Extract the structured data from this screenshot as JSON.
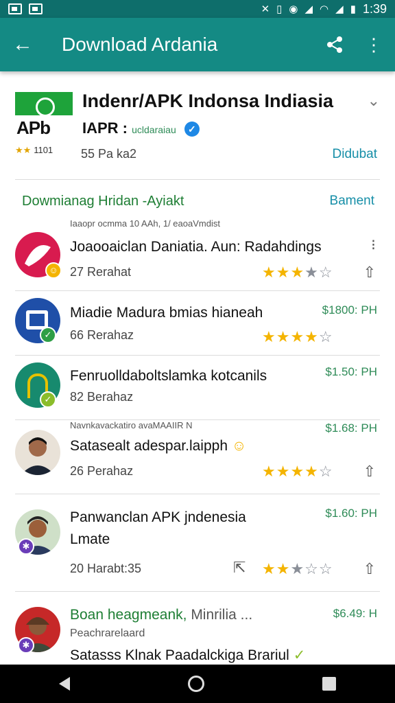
{
  "status_bar": {
    "time": "1:39"
  },
  "app_bar": {
    "title": "Download Ardania"
  },
  "app": {
    "title": "Indenr/APK Indonsa Indiasia",
    "logo_text": "APb",
    "developer": "IAPR :",
    "developer_tag": "ucldaraiau",
    "mini_rating": "★★",
    "mini_rating_text": "1101",
    "installs": "55 Pa ka2",
    "download_label": "Didubat"
  },
  "section": {
    "title": "Dowmianag Hridan -Ayiakt",
    "link": "Bament",
    "subtitle": "Iaaopr ocmma 10 AAh, 1/ eaoaVmdist"
  },
  "items": [
    {
      "title": "Joaooaiclan Daniatia. Aun: Radahdings",
      "sub": "27 Rerahat",
      "price": "",
      "note": "",
      "colors": {
        "avatar": "#d81b4f",
        "badge": "#f4b400"
      }
    },
    {
      "title": "Miadie Madura bmias hianeah",
      "sub": "66 Rerahaz",
      "price": "$1800: PH",
      "note": "",
      "colors": {
        "avatar": "#1f4fa8",
        "badge": "#2e9e46"
      }
    },
    {
      "title": "Fenruolldaboltslamka kotcanils",
      "sub": "82 Berahaz",
      "price": "$1.50: PH",
      "note": "",
      "colors": {
        "avatar": "#178a6e",
        "badge": "#8bbd2b"
      }
    },
    {
      "title": "Satasealt adespar.laipph",
      "sub": "26 Perahaz",
      "price": "$1.68: PH",
      "note": "Navnkavackatiro avaMAAIIR N",
      "colors": {
        "avatar": "#e9e2d8",
        "badge": ""
      }
    },
    {
      "title": "Panwanclan APK jndenesia",
      "title2": "Lmate",
      "sub": "20 Harabt:35",
      "price": "$1.60: PH",
      "note": "",
      "colors": {
        "avatar": "#cfe0c8",
        "badge": "#6a3db8"
      }
    },
    {
      "title": "Boan heagmeank,",
      "title_extra": "Minrilia ...",
      "sub": "Peachrarelaard",
      "title2": "Satasss Klnak Paadalckiga Brariul",
      "price": "$6.49: H",
      "note": "",
      "colors": {
        "avatar": "#c62828",
        "badge": "#6a3db8"
      }
    }
  ]
}
